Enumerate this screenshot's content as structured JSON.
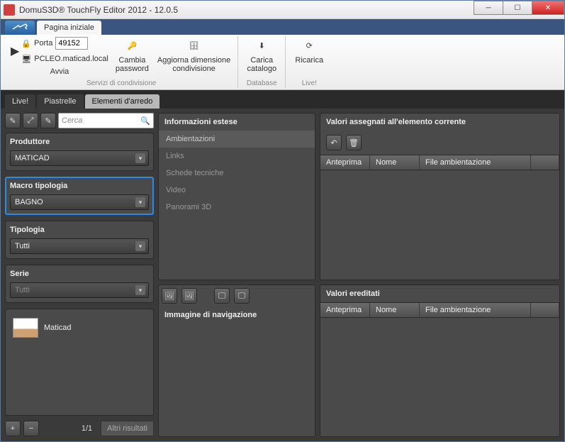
{
  "window": {
    "title": "DomuS3D® TouchFly Editor 2012 - 12.0.5"
  },
  "ribbon": {
    "tab_home": "Pagina iniziale",
    "avvia": "Avvia",
    "porta_label": "Porta",
    "porta_value": "49152",
    "host": "PCLEO.maticad.local",
    "group_servizi": "Servizi di condivisione",
    "cambia_password": "Cambia\npassword",
    "aggiorna_dim": "Aggiorna dimensione\ncondivisione",
    "carica_catalogo": "Carica\ncatalogo",
    "group_database": "Database",
    "ricarica": "Ricarica",
    "group_live": "Live!"
  },
  "innertabs": {
    "live": "Live!",
    "piastrelle": "Piastrelle",
    "arredo": "Elementi d'arredo"
  },
  "search": {
    "placeholder": "Cerca"
  },
  "filters": {
    "produttore_label": "Produttore",
    "produttore_value": "MATICAD",
    "macro_label": "Macro tipologia",
    "macro_value": "BAGNO",
    "tipologia_label": "Tipologia",
    "tipologia_value": "Tutti",
    "serie_label": "Serie",
    "serie_value": "Tutti"
  },
  "results": {
    "item0": "Maticad",
    "page": "1/1",
    "more": "Altri risultati"
  },
  "infoestese": {
    "title": "Informazioni estese",
    "ambientazioni": "Ambientazioni",
    "links": "Links",
    "schede": "Schede tecniche",
    "video": "Video",
    "panorami": "Panorami 3D"
  },
  "navimg": {
    "title": "Immagine di navigazione"
  },
  "valori_correnti": {
    "title": "Valori assegnati all'elemento corrente",
    "col_anteprima": "Anteprima",
    "col_nome": "Nome",
    "col_file": "File ambientazione"
  },
  "valori_ereditati": {
    "title": "Valori ereditati",
    "col_anteprima": "Anteprima",
    "col_nome": "Nome",
    "col_file": "File ambientazione"
  }
}
